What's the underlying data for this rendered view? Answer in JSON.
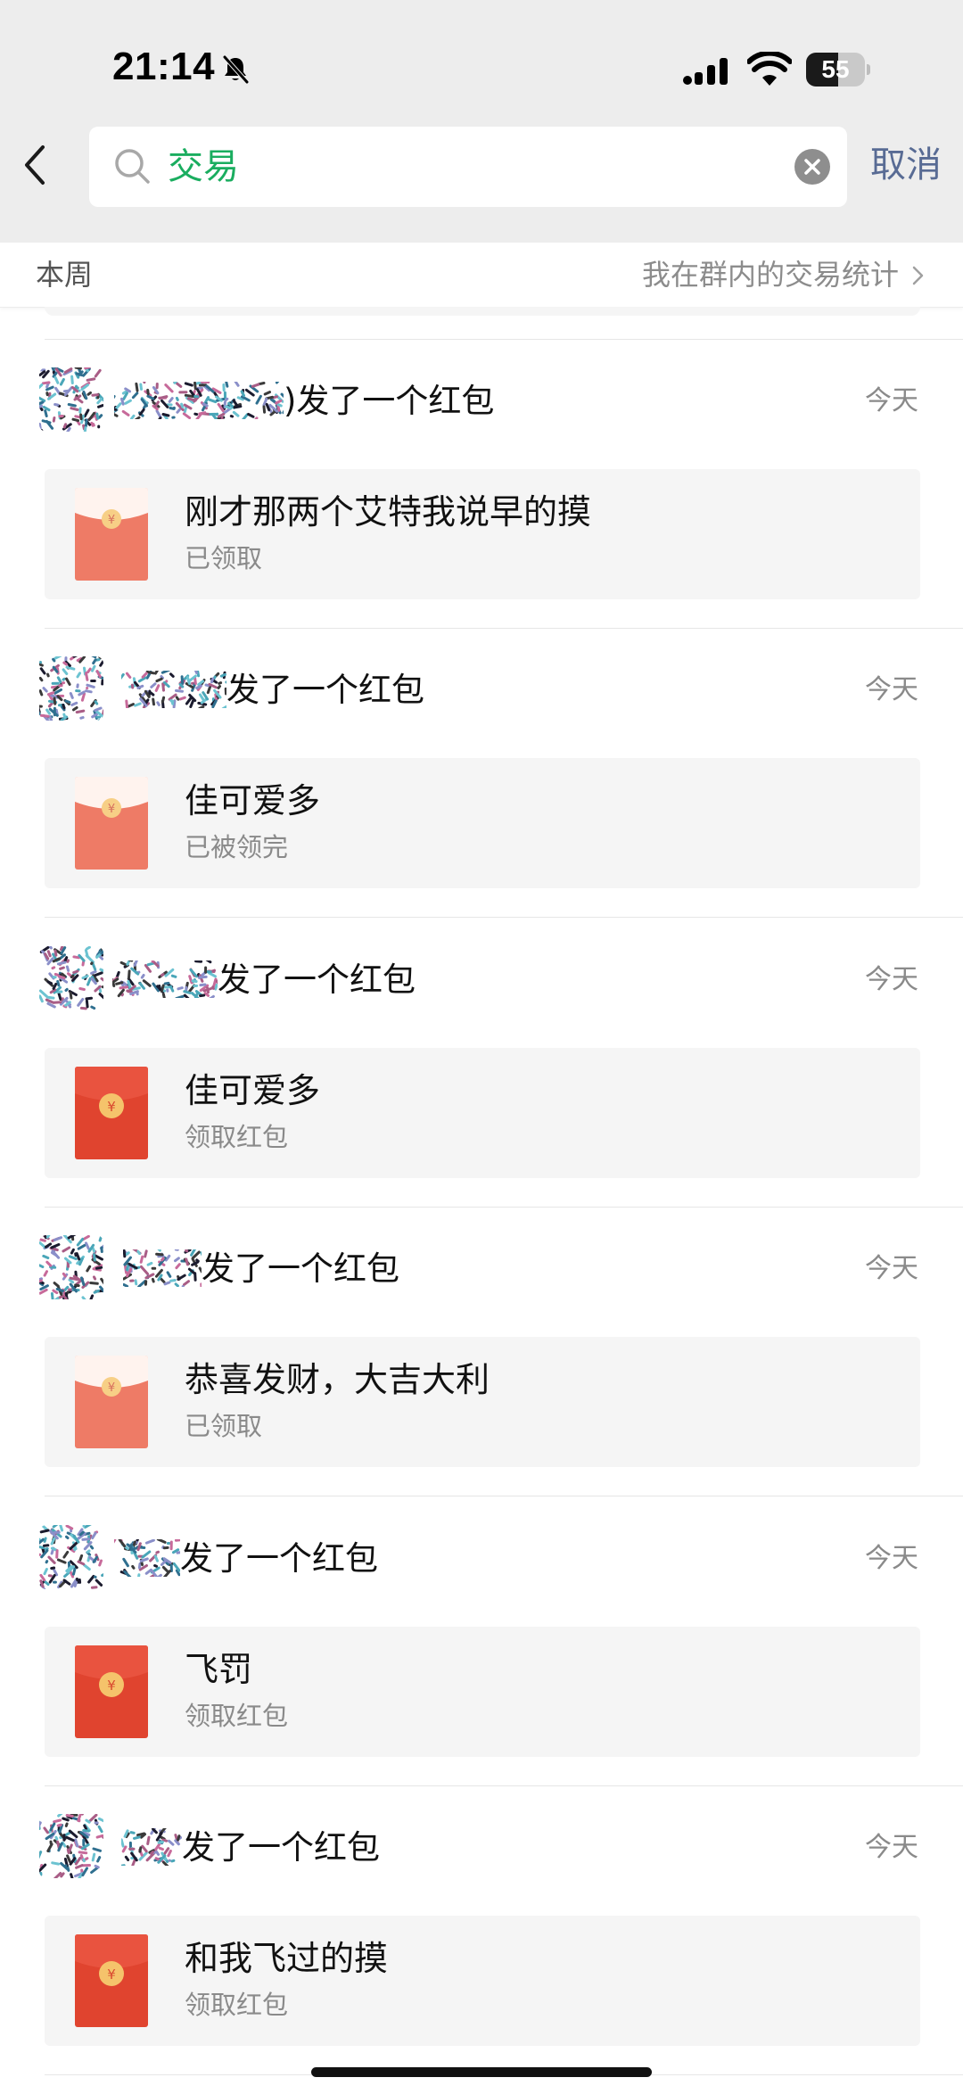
{
  "status_bar": {
    "time": "21:14",
    "battery": "55",
    "battery_level": 0.55
  },
  "search": {
    "query": "交易",
    "cancel_label": "取消"
  },
  "section": {
    "period": "本周",
    "stats_link": "我在群内的交易统计"
  },
  "results": [
    {
      "sender_suffix": ")发了一个红包",
      "time": "今天",
      "message": "刚才那两个艾特我说早的摸",
      "status": "已领取",
      "opened": true
    },
    {
      "sender_suffix": "发了一个红包",
      "time": "今天",
      "message": "佳可爱多",
      "status": "已被领完",
      "opened": true
    },
    {
      "sender_suffix": "发了一个红包",
      "time": "今天",
      "message": "佳可爱多",
      "status": "领取红包",
      "opened": false
    },
    {
      "sender_suffix": "发了一个红包",
      "time": "今天",
      "message": "恭喜发财，大吉大利",
      "status": "已领取",
      "opened": true
    },
    {
      "sender_suffix": "发了一个红包",
      "time": "今天",
      "message": "飞罚",
      "status": "领取红包",
      "opened": false
    },
    {
      "sender_suffix": "发了一个红包",
      "time": "今天",
      "message": "和我飞过的摸",
      "status": "领取红包",
      "opened": false
    }
  ],
  "colors": {
    "search_text": "#1aad5f",
    "cancel": "#586b94",
    "packet_unopened": "#e0442f",
    "packet_opened": "#ee7b66",
    "coin": "#f5c36b"
  },
  "icons": [
    "bell-muted-icon",
    "signal-icon",
    "wifi-icon",
    "back-chevron-icon",
    "search-icon",
    "clear-icon",
    "chevron-right-icon",
    "red-packet-icon"
  ]
}
